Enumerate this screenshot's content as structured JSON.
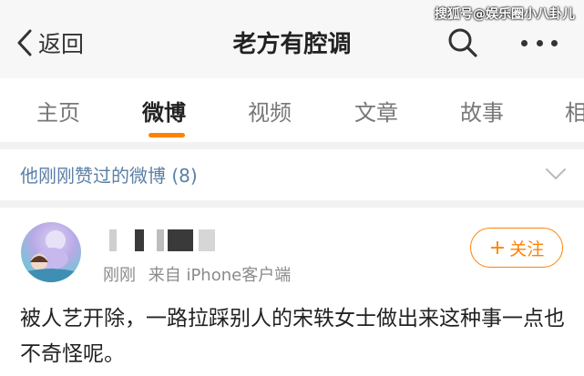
{
  "header": {
    "back_label": "返回",
    "title": "老方有腔调",
    "watermark": "搜狐号@娱乐圈小八卦儿"
  },
  "tabs": [
    {
      "label": "主页",
      "active": false
    },
    {
      "label": "微博",
      "active": true
    },
    {
      "label": "视频",
      "active": false
    },
    {
      "label": "文章",
      "active": false
    },
    {
      "label": "故事",
      "active": false
    },
    {
      "label": "相",
      "active": false
    }
  ],
  "liked": {
    "label": "他刚刚赞过的微博 (8)"
  },
  "post": {
    "time": "刚刚",
    "source": "来自 iPhone客户端",
    "follow_label": "关注",
    "text": "被人艺开除，一路拉踩别人的宋轶女士做出来这种事一点也不奇怪呢。"
  },
  "colors": {
    "accent": "#ff8200",
    "link": "#5b7fa6",
    "header_bg": "#f7f7f7"
  }
}
